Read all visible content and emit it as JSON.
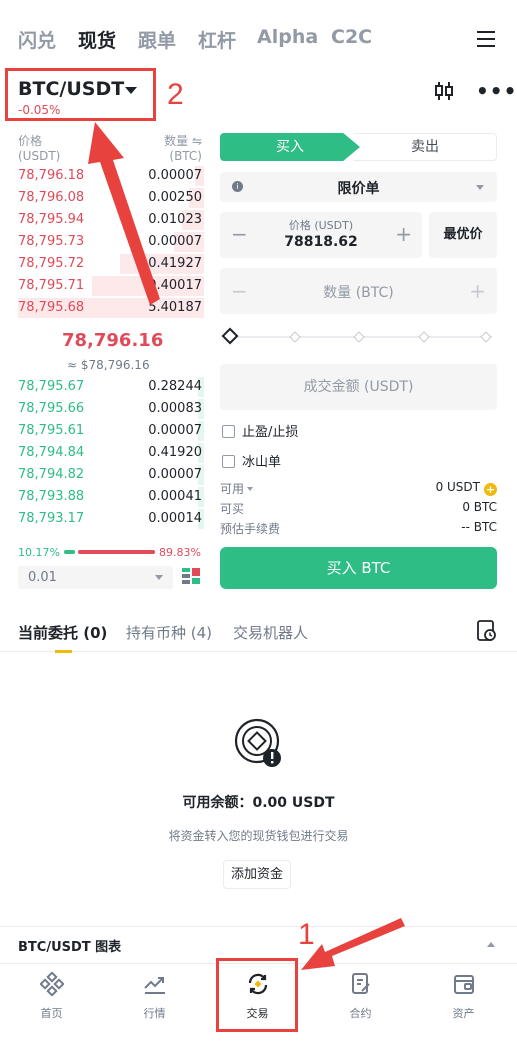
{
  "top_nav": {
    "tabs": [
      "闪兑",
      "现货",
      "跟单",
      "杠杆",
      "Alpha",
      "C2C"
    ],
    "active_index": 1
  },
  "pair": {
    "name": "BTC/USDT",
    "change": "-0.05%"
  },
  "annotations": {
    "step_1": "1",
    "step_2": "2",
    "color": "#e8423f"
  },
  "orderbook": {
    "price_header": "价格",
    "price_unit": "(USDT)",
    "qty_header": "数量 ⇋",
    "qty_unit": "(BTC)",
    "asks": [
      {
        "price": "78,796.18",
        "qty": "0.00007",
        "depth": 0.05
      },
      {
        "price": "78,796.08",
        "qty": "0.00250",
        "depth": 0.08
      },
      {
        "price": "78,795.94",
        "qty": "0.01023",
        "depth": 0.12
      },
      {
        "price": "78,795.73",
        "qty": "0.00007",
        "depth": 0.16
      },
      {
        "price": "78,795.72",
        "qty": "0.41927",
        "depth": 0.45
      },
      {
        "price": "78,795.71",
        "qty": "0.40017",
        "depth": 0.6
      },
      {
        "price": "78,795.68",
        "qty": "5.40187",
        "depth": 1.0
      }
    ],
    "last_price": "78,796.16",
    "last_price_fiat": "≈ $78,796.16",
    "bids": [
      {
        "price": "78,795.67",
        "qty": "0.28244",
        "depth": 0.03
      },
      {
        "price": "78,795.66",
        "qty": "0.00083",
        "depth": 0.03
      },
      {
        "price": "78,795.61",
        "qty": "0.00007",
        "depth": 0.03
      },
      {
        "price": "78,794.84",
        "qty": "0.41920",
        "depth": 0.03
      },
      {
        "price": "78,794.82",
        "qty": "0.00007",
        "depth": 0.03
      },
      {
        "price": "78,793.88",
        "qty": "0.00041",
        "depth": 0.03
      },
      {
        "price": "78,793.17",
        "qty": "0.00014",
        "depth": 0.03
      }
    ],
    "buy_ratio": "10.17%",
    "sell_ratio": "89.83%",
    "precision": "0.01",
    "colors": {
      "ask": "#e04a59",
      "bid": "#2ebd85"
    }
  },
  "trade_form": {
    "buy_tab": "买入",
    "sell_tab": "卖出",
    "order_type": "限价单",
    "price_label": "价格 (USDT)",
    "price_value": "78818.62",
    "best_price_button": "最优价",
    "qty_placeholder": "数量 (BTC)",
    "slider_percent": 0,
    "total_placeholder": "成交金额 (USDT)",
    "tp_sl_label": "止盈/止损",
    "iceberg_label": "冰山单",
    "available_label": "可用",
    "available_value": "0 USDT",
    "can_buy_label": "可买",
    "can_buy_value": "0 BTC",
    "fee_label": "预估手续费",
    "fee_value": "-- BTC",
    "buy_button": "买入 BTC",
    "accent": "#2ebd85"
  },
  "orders": {
    "tabs": [
      "当前委托 (0)",
      "持有币种 (4)",
      "交易机器人"
    ],
    "active_index": 0,
    "available_balance": "可用余额：0.00 USDT",
    "transfer_hint": "将资金转入您的现货钱包进行交易",
    "add_funds_button": "添加资金"
  },
  "chart_bar": {
    "title": "BTC/USDT 图表"
  },
  "bottom_nav": {
    "items": [
      {
        "label": "首页",
        "icon": "home-icon"
      },
      {
        "label": "行情",
        "icon": "markets-icon"
      },
      {
        "label": "交易",
        "icon": "trade-icon"
      },
      {
        "label": "合约",
        "icon": "futures-icon"
      },
      {
        "label": "资产",
        "icon": "wallet-icon"
      }
    ],
    "active_index": 2
  }
}
